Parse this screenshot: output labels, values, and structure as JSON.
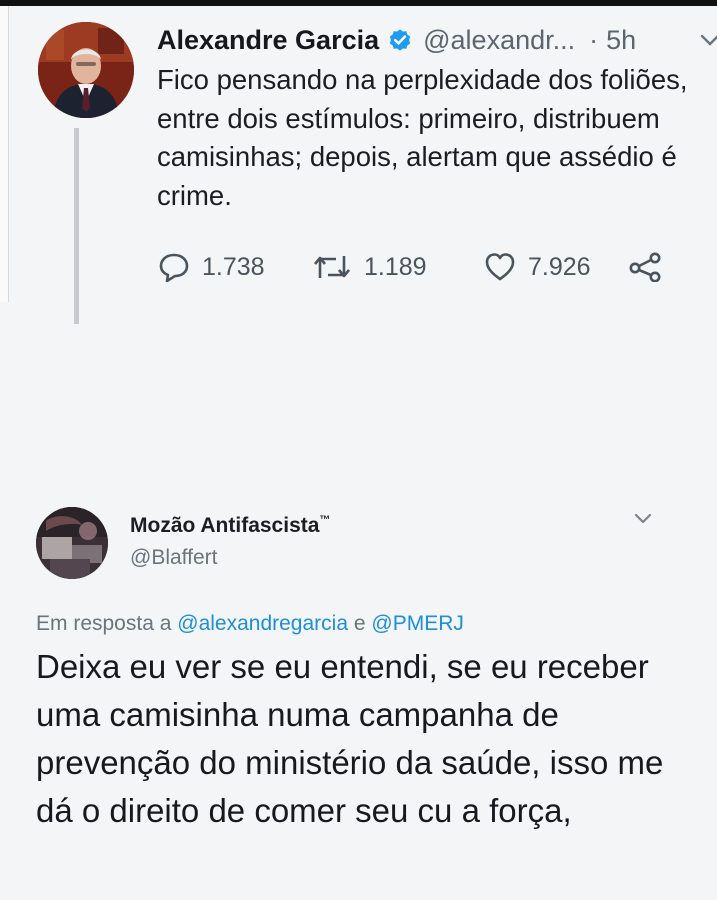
{
  "tweet_main": {
    "author_name": "Alexandre Garcia",
    "handle": "@alexandr...",
    "separator": "·",
    "time": "5h",
    "verified_icon": "verified-badge",
    "text": "Fico pensando na perplexidade dos foliões, entre dois estímulos: primeiro, distribuem camisinhas; depois, alertam que assédio é crime.",
    "actions": {
      "replies": "1.738",
      "retweets": "1.189",
      "likes": "7.926"
    },
    "colors": {
      "verified": "#1d9bf0",
      "meta": "#5b6670"
    }
  },
  "tweet_reply": {
    "author_name": "Mozão Antifascista",
    "name_suffix": "™",
    "handle": "@Blaffert",
    "reply_prefix": "Em resposta a",
    "reply_mention_1": "@alexandregarcia",
    "reply_conjunction": "e",
    "reply_mention_2": "@PMERJ",
    "text": "Deixa eu ver se eu entendi, se eu receber uma camisinha numa campanha de prevenção do ministério da saúde, isso me dá o direito de comer seu cu a força,",
    "colors": {
      "mention": "#1d8fd6"
    }
  }
}
